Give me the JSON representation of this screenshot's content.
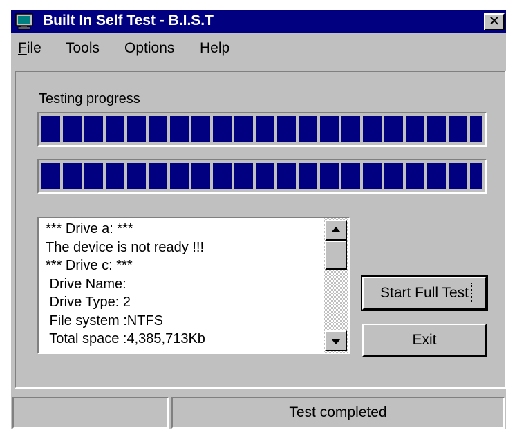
{
  "window": {
    "title": "Built In Self Test - B.I.S.T",
    "close_label": "✕"
  },
  "menu": {
    "file_mnemonic": "F",
    "file_rest": "ile",
    "tools": "Tools",
    "options": "Options",
    "help": "Help"
  },
  "progress": {
    "label": "Testing progress",
    "bar1_percent": 100,
    "bar2_percent": 100
  },
  "log": {
    "lines": [
      "*** Drive a: ***",
      "The device is not ready !!!",
      "*** Drive c: ***",
      " Drive Name:",
      " Drive Type: 2",
      " File system :NTFS",
      " Total space :4,385,713Kb"
    ],
    "scroll_up_icon": "scroll-up-arrow",
    "scroll_down_icon": "scroll-down-arrow"
  },
  "buttons": {
    "start_full_test": "Start Full Test",
    "exit": "Exit"
  },
  "status": {
    "pane1": "",
    "pane2": "Test completed"
  },
  "colors": {
    "title_bar": "#000080",
    "progress_fill": "#000080",
    "face": "#c0c0c0"
  }
}
